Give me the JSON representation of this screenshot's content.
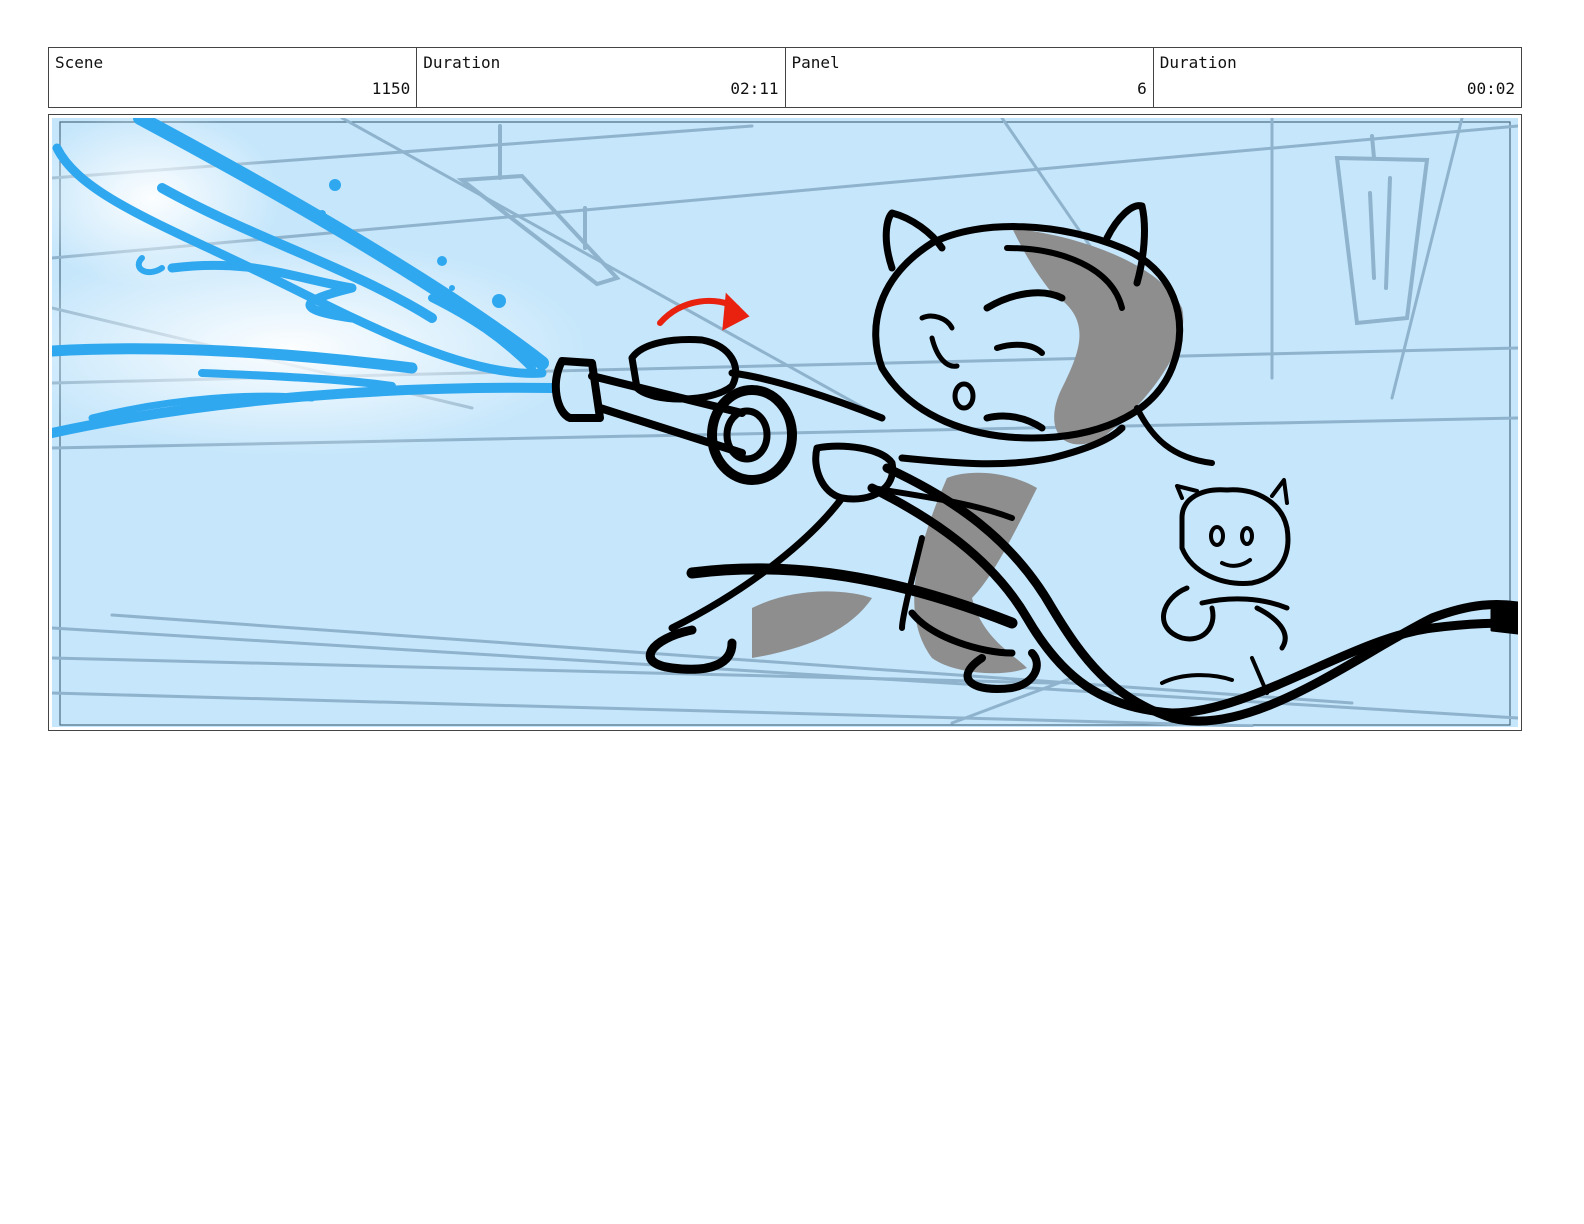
{
  "header": {
    "scene_label": "Scene",
    "scene_value": "1150",
    "scene_duration_label": "Duration",
    "scene_duration_value": "02:11",
    "panel_label": "Panel",
    "panel_value": "6",
    "panel_duration_label": "Duration",
    "panel_duration_value": "00:02"
  },
  "panel": {
    "background_color": "#c5e6fb",
    "water_color": "#2fa8f0",
    "ink_color": "#000000",
    "shadow_color": "#8e8e8e",
    "background_line_color": "#8fb3cc",
    "action_arrow_color": "#e8220f"
  }
}
